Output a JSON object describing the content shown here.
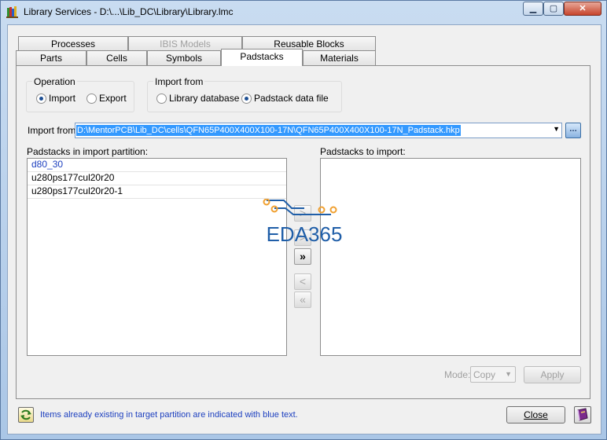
{
  "window": {
    "title": "Library Services - D:\\...\\Lib_DC\\Library\\Library.lmc",
    "controls": [
      "minimize",
      "maximize",
      "close"
    ]
  },
  "tabs": {
    "row1": [
      {
        "label": "Processes",
        "state": "normal"
      },
      {
        "label": "IBIS Models",
        "state": "disabled"
      },
      {
        "label": "Reusable Blocks",
        "state": "normal"
      }
    ],
    "row2": [
      {
        "label": "Parts",
        "state": "normal"
      },
      {
        "label": "Cells",
        "state": "normal"
      },
      {
        "label": "Symbols",
        "state": "normal"
      },
      {
        "label": "Padstacks",
        "state": "active"
      },
      {
        "label": "Materials",
        "state": "normal"
      }
    ]
  },
  "operation": {
    "title": "Operation",
    "options": [
      {
        "label": "Import",
        "selected": true
      },
      {
        "label": "Export",
        "selected": false
      }
    ]
  },
  "import_from_group": {
    "title": "Import from",
    "options": [
      {
        "label": "Library database",
        "selected": false
      },
      {
        "label": "Padstack data file",
        "selected": true
      }
    ]
  },
  "import_path": {
    "label": "Import from:",
    "value": "D:\\MentorPCB\\Lib_DC\\cells\\QFN65P400X400X100-17N\\QFN65P400X400X100-17N_Padstack.hkp"
  },
  "source_list": {
    "label": "Padstacks in import partition:",
    "items": [
      {
        "text": "d80_30",
        "existing": true
      },
      {
        "text": "u280ps177cul20r20",
        "existing": false
      },
      {
        "text": "u280ps177cul20r20-1",
        "existing": false
      }
    ]
  },
  "target_list": {
    "label": "Padstacks to import:",
    "items": []
  },
  "move_buttons": {
    "add_one": ">",
    "add_all": "»",
    "remove_one": "<",
    "remove_all": "«"
  },
  "mode": {
    "label": "Mode:",
    "value": "Copy"
  },
  "apply_label": "Apply",
  "close_label": "Close",
  "status_message": "Items already existing in target partition are indicated with blue text.",
  "watermark_text": "EDA365",
  "colors": {
    "existing_item": "#1c3fbf",
    "selection": "#3399ff",
    "watermark": "#1f5ea8",
    "watermark_dots": "#f0a030"
  }
}
